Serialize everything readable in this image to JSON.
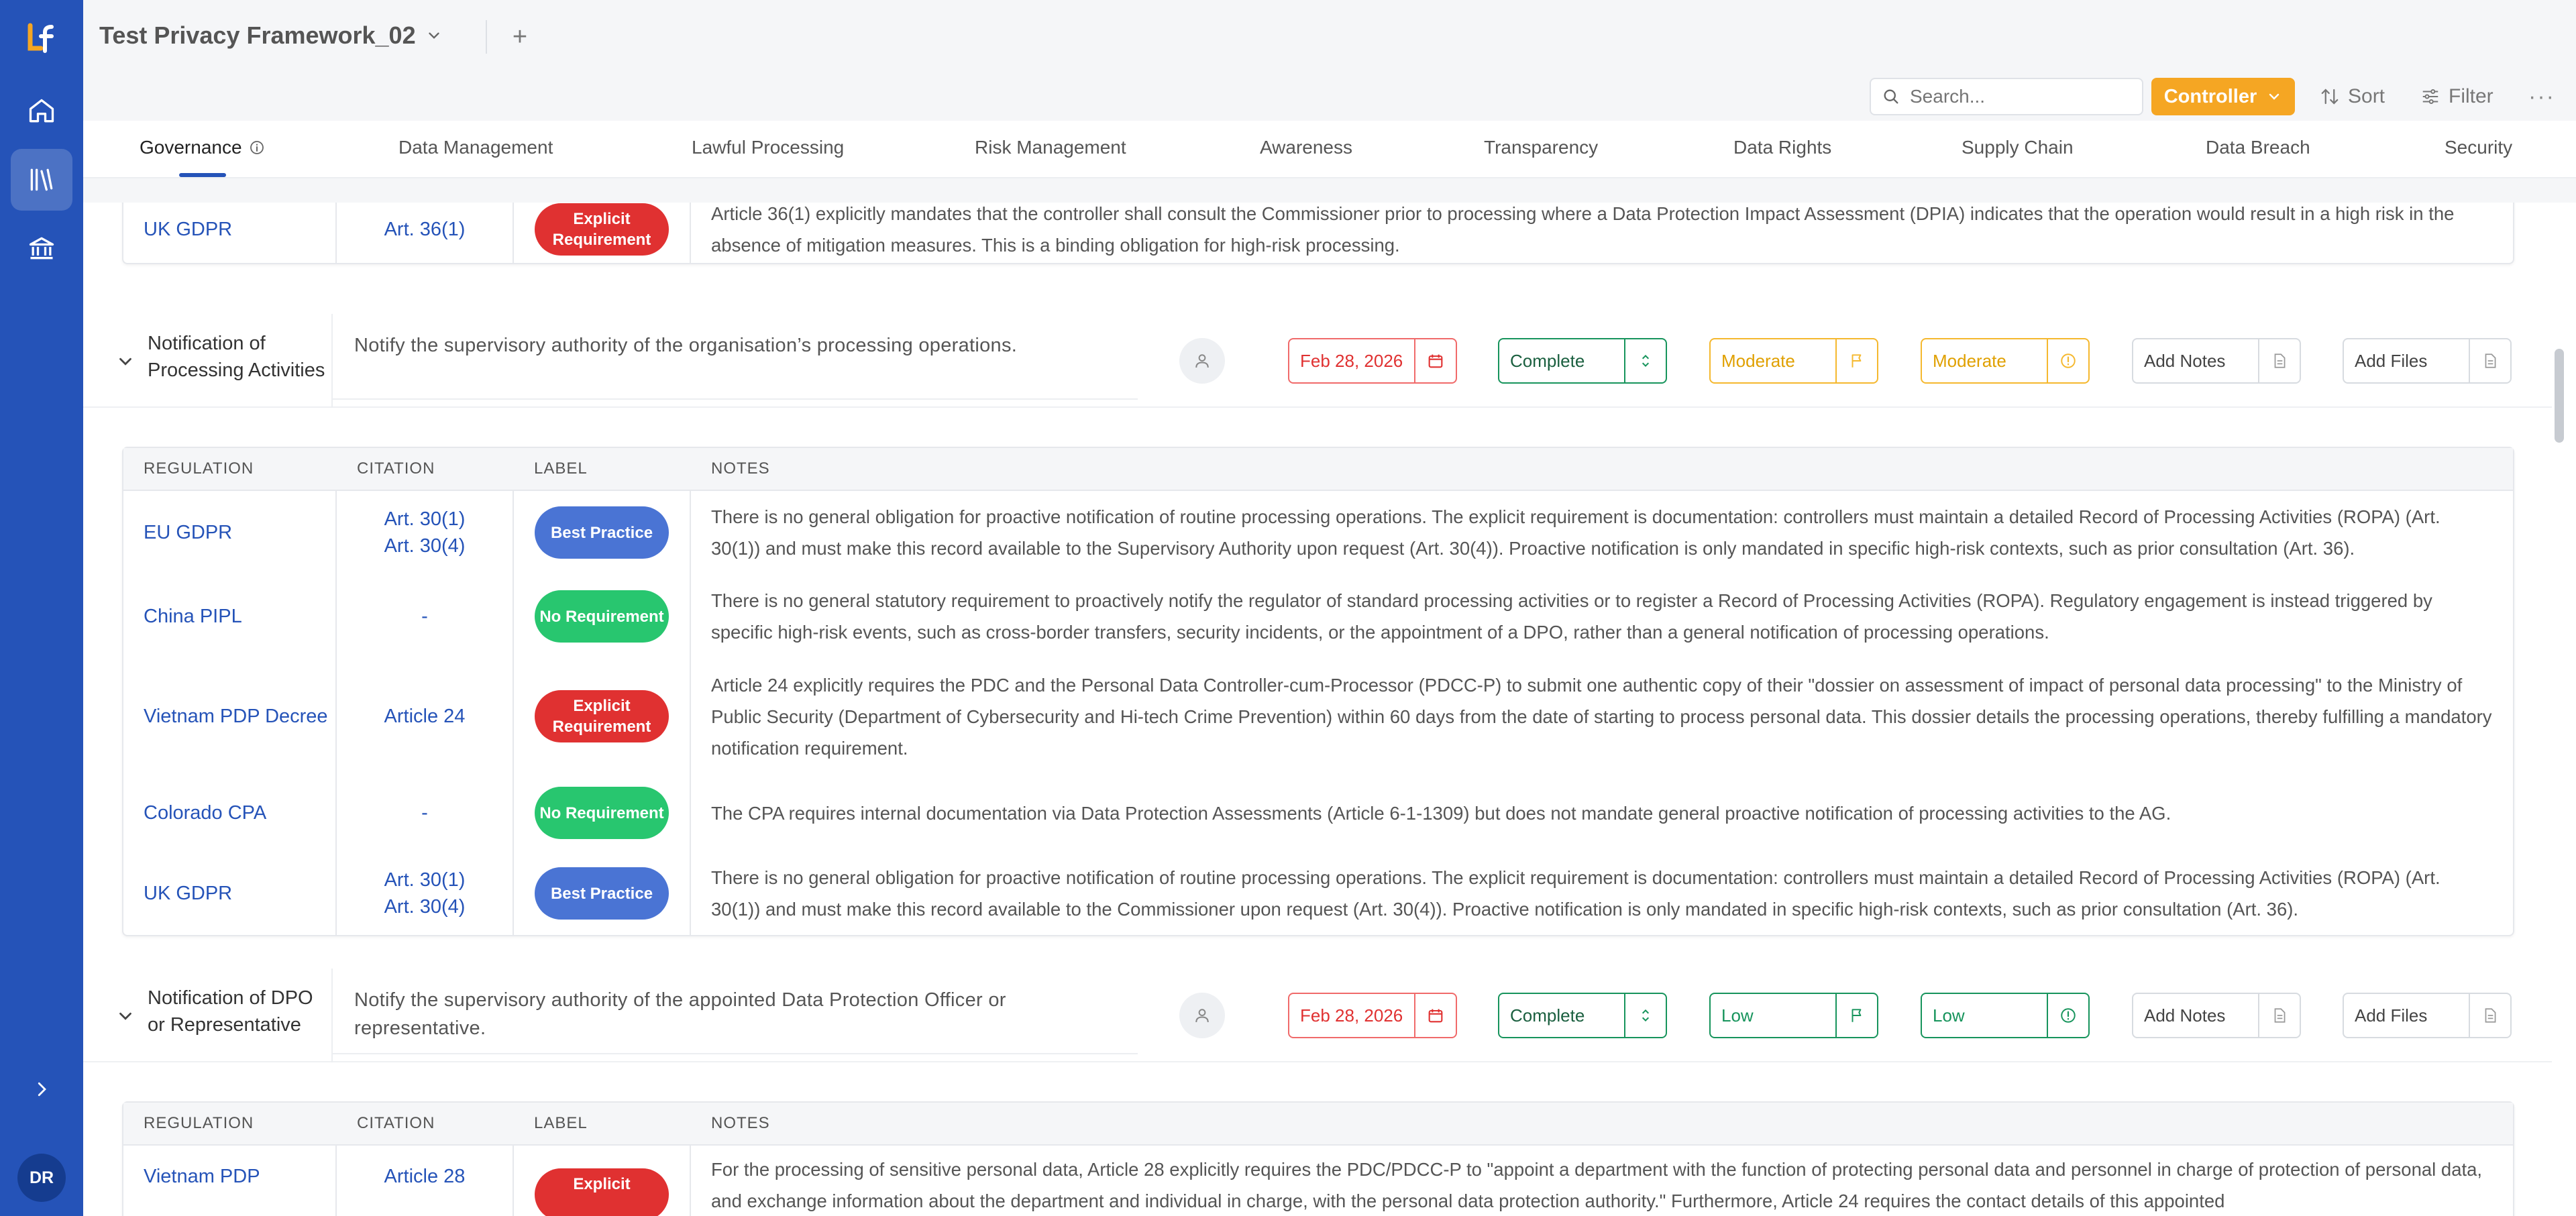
{
  "app": {
    "logo_text": "LF",
    "project_title": "Test Privacy Framework_02",
    "user_initials": "DR"
  },
  "toolbar": {
    "search_placeholder": "Search...",
    "role_label": "Controller",
    "sort_label": "Sort",
    "filter_label": "Filter"
  },
  "tabs": [
    {
      "label": "Governance",
      "active": true
    },
    {
      "label": "Data Management"
    },
    {
      "label": "Lawful Processing"
    },
    {
      "label": "Risk Management"
    },
    {
      "label": "Awareness"
    },
    {
      "label": "Transparency"
    },
    {
      "label": "Data Rights"
    },
    {
      "label": "Supply Chain"
    },
    {
      "label": "Data Breach"
    },
    {
      "label": "Security"
    }
  ],
  "table_headers": {
    "regulation": "REGULATION",
    "citation": "CITATION",
    "label": "LABEL",
    "notes": "NOTES"
  },
  "prev_row": {
    "regulation": "UK GDPR",
    "citation": "Art. 36(1)",
    "label": "Explicit Requirement",
    "notes": "Article 36(1) explicitly mandates that the controller shall consult the Commissioner prior to processing where a Data Protection Impact Assessment (DPIA) indicates that the operation would result in a high risk in the absence of mitigation measures. This is a binding obligation for high-risk processing."
  },
  "controls": [
    {
      "name": "Notification of Processing Activities",
      "description": "Notify the supervisory authority of the organisation’s processing operations.",
      "due_date": "Feb 28, 2026",
      "status": "Complete",
      "risk_a": "Moderate",
      "risk_b": "Moderate",
      "notes_label": "Add Notes",
      "files_label": "Add Files",
      "rows": [
        {
          "regulation": "EU GDPR",
          "citation": [
            "Art. 30(1)",
            "Art. 30(4)"
          ],
          "label": "Best Practice",
          "notes": "There is no general obligation for proactive notification of routine processing operations. The explicit requirement is documentation: controllers must maintain a detailed Record of Processing Activities (ROPA) (Art. 30(1)) and must make this record available to the Supervisory Authority upon request (Art. 30(4)). Proactive notification is only mandated in specific high-risk contexts, such as prior consultation (Art. 36)."
        },
        {
          "regulation": "China PIPL",
          "citation": [
            "-"
          ],
          "label": "No Requirement",
          "notes": "There is no general statutory requirement to proactively notify the regulator of standard processing activities or to register a Record of Processing Activities (ROPA). Regulatory engagement is instead triggered by specific high-risk events, such as cross-border transfers, security incidents, or the appointment of a DPO, rather than a general notification of processing operations."
        },
        {
          "regulation": "Vietnam PDP Decree",
          "citation": [
            "Article 24"
          ],
          "label": "Explicit Requirement",
          "notes": "Article 24 explicitly requires the PDC and the Personal Data Controller-cum-Processor (PDCC-P) to submit one authentic copy of their \"dossier on assessment of impact of personal data processing\" to the Ministry of Public Security (Department of Cybersecurity and Hi-tech Crime Prevention) within 60 days from the date of starting to process personal data. This dossier details the processing operations, thereby fulfilling a mandatory notification requirement."
        },
        {
          "regulation": "Colorado CPA",
          "citation": [
            "-"
          ],
          "label": "No Requirement",
          "notes": "The CPA requires internal documentation via Data Protection Assessments (Article 6-1-1309) but does not mandate general proactive notification of processing activities to the AG."
        },
        {
          "regulation": "UK GDPR",
          "citation": [
            "Art. 30(1)",
            "Art. 30(4)"
          ],
          "label": "Best Practice",
          "notes": "There is no general obligation for proactive notification of routine processing operations. The explicit requirement is documentation: controllers must maintain a detailed Record of Processing Activities (ROPA) (Art. 30(1)) and must make this record available to the Commissioner upon request (Art. 30(4)). Proactive notification is only mandated in specific high-risk contexts, such as prior consultation (Art. 36)."
        }
      ]
    },
    {
      "name": "Notification of DPO or Representative",
      "description": "Notify the supervisory authority of the appointed Data Protection Officer or representative.",
      "due_date": "Feb 28, 2026",
      "status": "Complete",
      "risk_a": "Low",
      "risk_b": "Low",
      "notes_label": "Add Notes",
      "files_label": "Add Files",
      "rows": [
        {
          "regulation": "Vietnam PDP",
          "citation": [
            "Article 28"
          ],
          "label": "Explicit",
          "notes": "For the processing of sensitive personal data, Article 28 explicitly requires the PDC/PDCC-P to \"appoint a department with the function of protecting personal data and personnel in charge of protection of personal data, and exchange information about the department and individual in charge, with the personal data protection authority.\" Furthermore, Article 24 requires the contact details of this appointed"
        }
      ]
    }
  ],
  "colors": {
    "sidebar": "#2553b8",
    "accent_orange": "#f5a623",
    "explicit": "#e03131",
    "best_practice": "#4a74d4",
    "no_requirement": "#28c66f"
  }
}
